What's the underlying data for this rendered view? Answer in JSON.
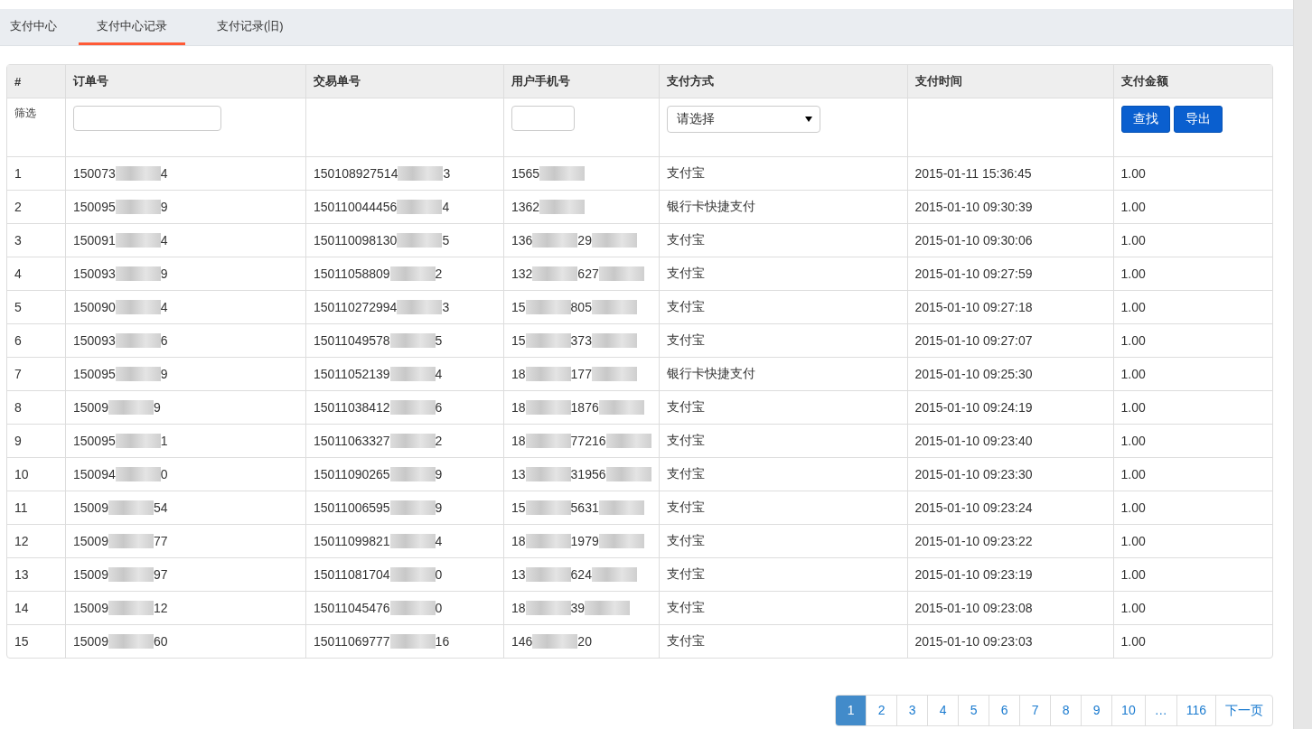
{
  "tabs": [
    {
      "label": "支付中心",
      "selected": false
    },
    {
      "label": "支付中心记录",
      "selected": true
    },
    {
      "label": "支付记录(旧)",
      "selected": false
    }
  ],
  "table": {
    "columns": [
      "#",
      "订单号",
      "交易单号",
      "用户手机号",
      "支付方式",
      "支付时间",
      "支付金额"
    ],
    "filter": {
      "label": "筛选",
      "select": "请选择",
      "buttons": [
        "查找",
        "导出"
      ]
    },
    "rows": [
      {
        "no": "1",
        "order": {
          "parts": [
            "150073",
            "4"
          ],
          "trailing_blur": false
        },
        "trade": {
          "parts": [
            "150108927514",
            "3"
          ],
          "trailing_blur": false
        },
        "phone": {
          "parts": [
            "1565"
          ],
          "trailing_blur": true
        },
        "method": "支付宝",
        "time": "2015-01-11 15:36:45",
        "amount": "1.00"
      },
      {
        "no": "2",
        "order": {
          "parts": [
            "150095",
            "9"
          ],
          "trailing_blur": false
        },
        "trade": {
          "parts": [
            "150110044456",
            "4"
          ],
          "trailing_blur": false
        },
        "phone": {
          "parts": [
            "1362"
          ],
          "trailing_blur": true
        },
        "method": "银行卡快捷支付",
        "time": "2015-01-10 09:30:39",
        "amount": "1.00"
      },
      {
        "no": "3",
        "order": {
          "parts": [
            "150091",
            "4"
          ],
          "trailing_blur": false
        },
        "trade": {
          "parts": [
            "150110098130",
            "5"
          ],
          "trailing_blur": false
        },
        "phone": {
          "parts": [
            "136",
            "29"
          ],
          "trailing_blur": true
        },
        "method": "支付宝",
        "time": "2015-01-10 09:30:06",
        "amount": "1.00"
      },
      {
        "no": "4",
        "order": {
          "parts": [
            "150093",
            "9"
          ],
          "trailing_blur": false
        },
        "trade": {
          "parts": [
            "15011058809",
            "2"
          ],
          "trailing_blur": false
        },
        "phone": {
          "parts": [
            "132",
            "627"
          ],
          "trailing_blur": true
        },
        "method": "支付宝",
        "time": "2015-01-10 09:27:59",
        "amount": "1.00"
      },
      {
        "no": "5",
        "order": {
          "parts": [
            "150090",
            "4"
          ],
          "trailing_blur": false
        },
        "trade": {
          "parts": [
            "150110272994",
            "3"
          ],
          "trailing_blur": false
        },
        "phone": {
          "parts": [
            "15",
            "805"
          ],
          "trailing_blur": true
        },
        "method": "支付宝",
        "time": "2015-01-10 09:27:18",
        "amount": "1.00"
      },
      {
        "no": "6",
        "order": {
          "parts": [
            "150093",
            "6"
          ],
          "trailing_blur": false
        },
        "trade": {
          "parts": [
            "15011049578",
            "5"
          ],
          "trailing_blur": false
        },
        "phone": {
          "parts": [
            "15",
            "373"
          ],
          "trailing_blur": true
        },
        "method": "支付宝",
        "time": "2015-01-10 09:27:07",
        "amount": "1.00"
      },
      {
        "no": "7",
        "order": {
          "parts": [
            "150095",
            "9"
          ],
          "trailing_blur": false
        },
        "trade": {
          "parts": [
            "15011052139",
            "4"
          ],
          "trailing_blur": false
        },
        "phone": {
          "parts": [
            "18",
            "177"
          ],
          "trailing_blur": true
        },
        "method": "银行卡快捷支付",
        "time": "2015-01-10 09:25:30",
        "amount": "1.00"
      },
      {
        "no": "8",
        "order": {
          "parts": [
            "15009",
            "9"
          ],
          "trailing_blur": false
        },
        "trade": {
          "parts": [
            "15011038412",
            "6"
          ],
          "trailing_blur": false
        },
        "phone": {
          "parts": [
            "18",
            "1876"
          ],
          "trailing_blur": true
        },
        "method": "支付宝",
        "time": "2015-01-10 09:24:19",
        "amount": "1.00"
      },
      {
        "no": "9",
        "order": {
          "parts": [
            "150095",
            "1"
          ],
          "trailing_blur": false
        },
        "trade": {
          "parts": [
            "15011063327",
            "2"
          ],
          "trailing_blur": false
        },
        "phone": {
          "parts": [
            "18",
            "77216"
          ],
          "trailing_blur": true
        },
        "method": "支付宝",
        "time": "2015-01-10 09:23:40",
        "amount": "1.00"
      },
      {
        "no": "10",
        "order": {
          "parts": [
            "150094",
            "0"
          ],
          "trailing_blur": false
        },
        "trade": {
          "parts": [
            "15011090265",
            "9"
          ],
          "trailing_blur": false
        },
        "phone": {
          "parts": [
            "13",
            "31956"
          ],
          "trailing_blur": true
        },
        "method": "支付宝",
        "time": "2015-01-10 09:23:30",
        "amount": "1.00"
      },
      {
        "no": "11",
        "order": {
          "parts": [
            "15009",
            "54"
          ],
          "trailing_blur": false
        },
        "trade": {
          "parts": [
            "15011006595",
            "9"
          ],
          "trailing_blur": false
        },
        "phone": {
          "parts": [
            "15",
            "5631"
          ],
          "trailing_blur": true
        },
        "method": "支付宝",
        "time": "2015-01-10 09:23:24",
        "amount": "1.00"
      },
      {
        "no": "12",
        "order": {
          "parts": [
            "15009",
            "77"
          ],
          "trailing_blur": false
        },
        "trade": {
          "parts": [
            "15011099821",
            "4"
          ],
          "trailing_blur": false
        },
        "phone": {
          "parts": [
            "18",
            "1979"
          ],
          "trailing_blur": true
        },
        "method": "支付宝",
        "time": "2015-01-10 09:23:22",
        "amount": "1.00"
      },
      {
        "no": "13",
        "order": {
          "parts": [
            "15009",
            "97"
          ],
          "trailing_blur": false
        },
        "trade": {
          "parts": [
            "15011081704",
            "0"
          ],
          "trailing_blur": false
        },
        "phone": {
          "parts": [
            "13",
            "624"
          ],
          "trailing_blur": true
        },
        "method": "支付宝",
        "time": "2015-01-10 09:23:19",
        "amount": "1.00"
      },
      {
        "no": "14",
        "order": {
          "parts": [
            "15009",
            "12"
          ],
          "trailing_blur": false
        },
        "trade": {
          "parts": [
            "15011045476",
            "0"
          ],
          "trailing_blur": false
        },
        "phone": {
          "parts": [
            "18",
            "39"
          ],
          "trailing_blur": true
        },
        "method": "支付宝",
        "time": "2015-01-10 09:23:08",
        "amount": "1.00"
      },
      {
        "no": "15",
        "order": {
          "parts": [
            "15009",
            "60"
          ],
          "trailing_blur": false
        },
        "trade": {
          "parts": [
            "15011069777",
            "16"
          ],
          "trailing_blur": false
        },
        "phone": {
          "parts": [
            "146",
            "20"
          ],
          "trailing_blur": false
        },
        "method": "支付宝",
        "time": "2015-01-10 09:23:03",
        "amount": "1.00"
      }
    ]
  },
  "pagination": [
    {
      "label": "1",
      "selected": true
    },
    {
      "label": "2",
      "selected": false
    },
    {
      "label": "3",
      "selected": false
    },
    {
      "label": "4",
      "selected": false
    },
    {
      "label": "5",
      "selected": false
    },
    {
      "label": "6",
      "selected": false
    },
    {
      "label": "7",
      "selected": false
    },
    {
      "label": "8",
      "selected": false
    },
    {
      "label": "9",
      "selected": false
    },
    {
      "label": "10",
      "selected": false
    },
    {
      "label": "…",
      "selected": false
    },
    {
      "label": "116",
      "selected": false
    },
    {
      "label": "下一页",
      "selected": false
    }
  ]
}
